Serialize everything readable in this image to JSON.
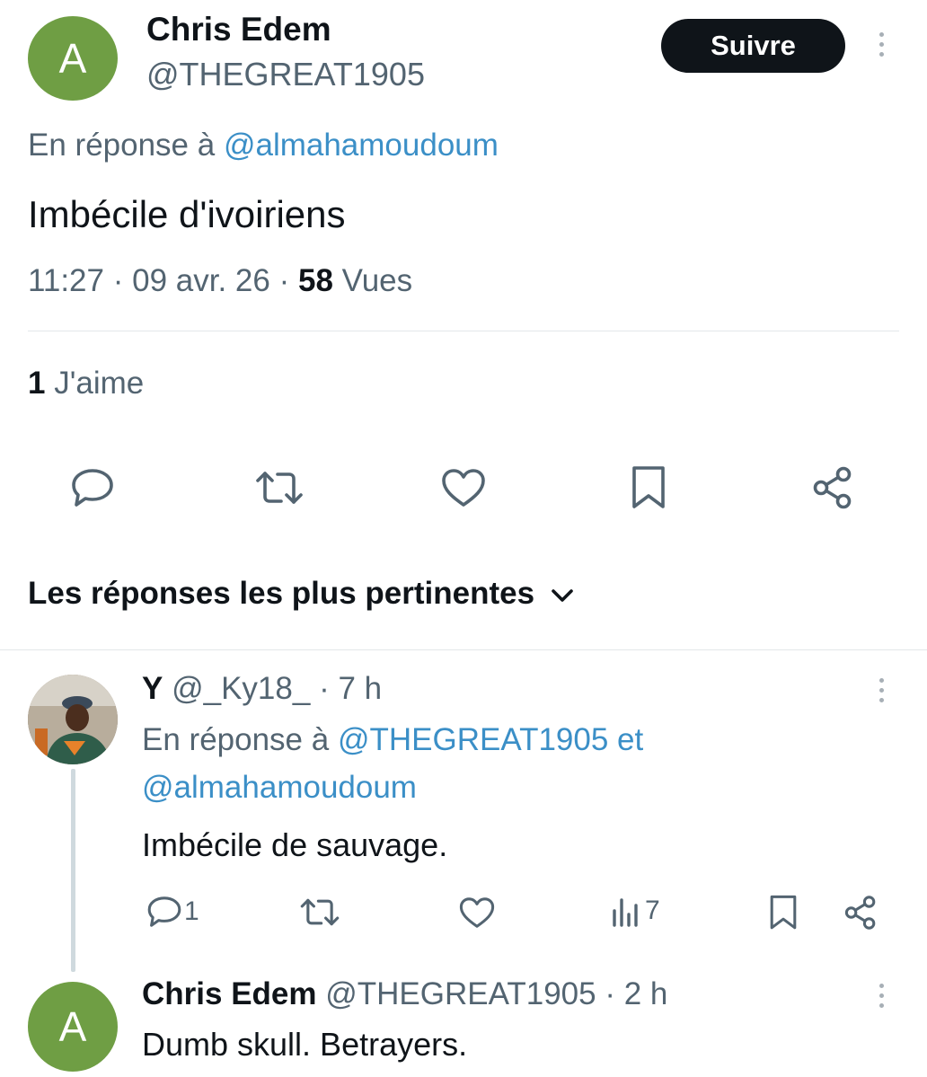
{
  "main_tweet": {
    "avatar_letter": "A",
    "avatar_color": "#6f9e44",
    "display_name": "Chris Edem",
    "handle": "@THEGREAT1905",
    "follow_label": "Suivre",
    "reply_prefix": "En réponse à",
    "reply_to": "@almahamoudoum",
    "text": "Imbécile d'ivoiriens",
    "time": "11:27",
    "date": "09 avr. 26",
    "separator": "·",
    "views_count": "58",
    "views_label": "Vues",
    "likes_count": "1",
    "likes_label": "J'aime",
    "actions": [
      "reply-icon",
      "retweet-icon",
      "like-icon",
      "bookmark-icon",
      "share-icon"
    ]
  },
  "replies_sort": {
    "label": "Les réponses les plus pertinentes"
  },
  "reply_1": {
    "display_name": "Y",
    "handle": "@_Ky18_",
    "time_ago": "7 h",
    "reply_prefix": "En réponse à",
    "reply_to_1": "@THEGREAT1905 et",
    "reply_to_2": "@almahamoudoum",
    "text": "Imbécile de sauvage.",
    "reply_count": "1",
    "views_count": "7"
  },
  "reply_2": {
    "avatar_letter": "A",
    "display_name": "Chris Edem",
    "handle": "@THEGREAT1905",
    "time_ago": "2 h",
    "text": "Dumb skull. Betrayers."
  },
  "colors": {
    "accent_link": "#3b8fc7",
    "muted_text": "#536471",
    "follow_button_bg": "#0f1419"
  }
}
